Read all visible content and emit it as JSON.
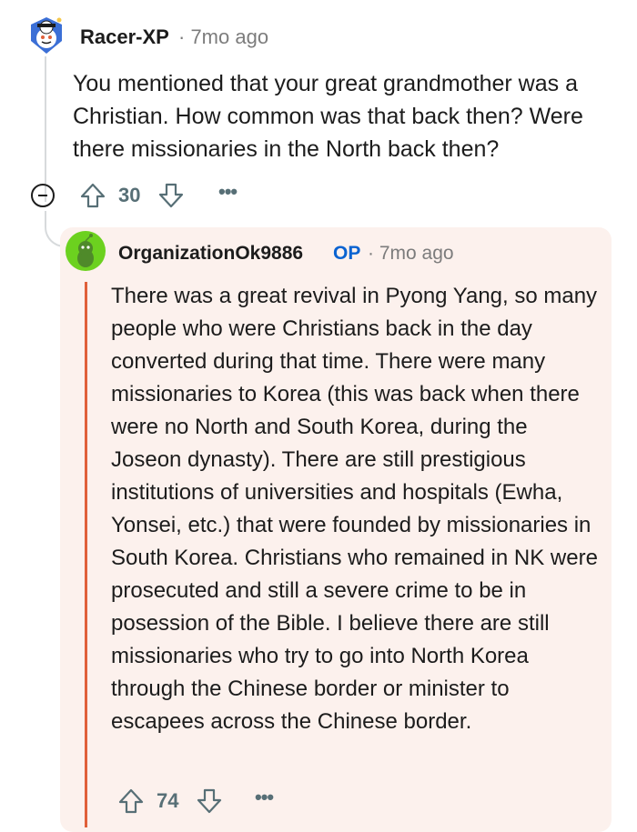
{
  "comment": {
    "avatar_icon": "snoo-avatar-icon",
    "author": "Racer-XP",
    "meta": "· 7mo ago",
    "body": "You mentioned that your great grandmother was a Christian. How common was that back then? Were there missionaries in the North back then?",
    "score": "30",
    "more_label": "•••"
  },
  "reply": {
    "avatar_icon": "snoo-avatar-icon",
    "author": "OrganizationOk9886",
    "op_label": "OP",
    "meta": "· 7mo ago",
    "body": "There was a great revival in Pyong Yang, so many people who were Christians back in the day converted during that time. There were many missionaries to Korea (this was back when there were no North and South Korea, during the Joseon dynasty). There are still prestigious institutions of universities and hospitals (Ewha, Yonsei, etc.) that were founded by missionaries in South Korea. Christians who remained in NK were prosecuted and still a severe crime to be in posession of the Bible. I believe there are still missionaries who try to go into North Korea through the Chinese border or minister to escapees across the Chinese border.",
    "score": "74",
    "more_label": "•••",
    "highlight_color": "#fcf1ed",
    "accent_color": "#e0603a"
  },
  "colors": {
    "op_blue": "#0a63d1",
    "meta_gray": "#7c7c7c",
    "action_gray": "#576f76"
  }
}
